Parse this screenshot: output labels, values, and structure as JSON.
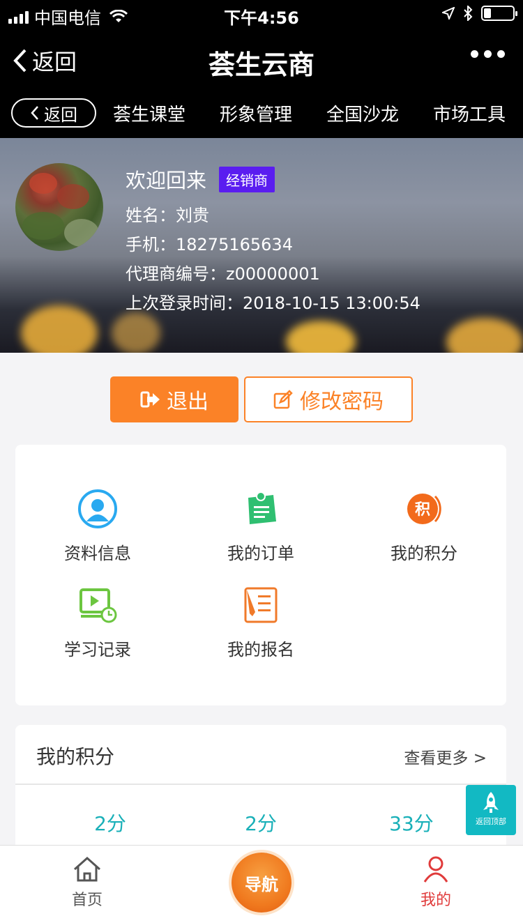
{
  "status_bar": {
    "carrier": "中国电信",
    "time": "下午4:56"
  },
  "nav": {
    "back_label": "返回",
    "title": "荟生云商"
  },
  "subtabs": {
    "back_label": "返回",
    "items": [
      "荟生课堂",
      "形象管理",
      "全国沙龙",
      "市场工具"
    ]
  },
  "profile": {
    "welcome": "欢迎回来",
    "role_badge": "经销商",
    "name_line": "姓名：刘贵",
    "phone_line": "手机：18275165634",
    "agent_line": "代理商编号：z00000001",
    "last_login_line": "上次登录时间：2018-10-15 13:00:54"
  },
  "actions": {
    "logout": "退出",
    "change_password": "修改密码"
  },
  "menu": {
    "items": [
      {
        "label": "资料信息",
        "icon": "user-profile-icon",
        "color": "#29a9f0"
      },
      {
        "label": "我的订单",
        "icon": "order-icon",
        "color": "#2fbf71"
      },
      {
        "label": "我的积分",
        "icon": "points-icon",
        "color": "#f26a1b"
      },
      {
        "label": "学习记录",
        "icon": "study-record-icon",
        "color": "#6cc640"
      },
      {
        "label": "我的报名",
        "icon": "signup-icon",
        "color": "#f07a2a"
      }
    ]
  },
  "points": {
    "title": "我的积分",
    "more": "查看更多 >",
    "values": [
      "2分",
      "2分",
      "33分"
    ]
  },
  "back_top": {
    "label": "返回顶部"
  },
  "tabbar": {
    "home": "首页",
    "center": "导航",
    "mine": "我的"
  },
  "colors": {
    "accent_orange": "#fb8227",
    "teal": "#19b0b8",
    "active_tab_red": "#e03b3b",
    "badge_purple": "#5a1df0"
  }
}
